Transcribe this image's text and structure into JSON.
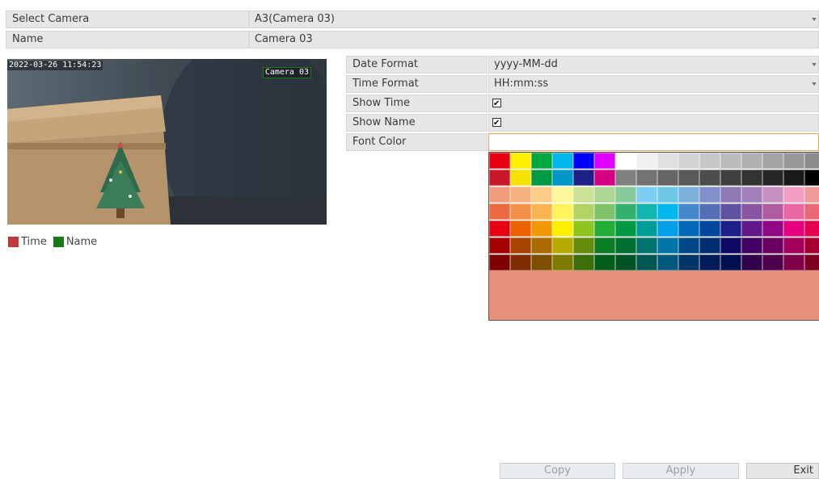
{
  "camera_row": {
    "label": "Select Camera",
    "value": "A3(Camera 03)"
  },
  "name_row": {
    "label": "Name",
    "value": "Camera 03"
  },
  "preview": {
    "timestamp": "2022-03-26 11:54:23",
    "camera_name": "Camera 03"
  },
  "legend": {
    "time_label": "Time",
    "time_color": "#c0393a",
    "name_label": "Name",
    "name_color": "#1a7a1a"
  },
  "settings": {
    "date_format": {
      "label": "Date Format",
      "value": "yyyy-MM-dd"
    },
    "time_format": {
      "label": "Time Format",
      "value": "HH:mm:ss"
    },
    "show_time": {
      "label": "Show Time",
      "checked": true,
      "mark": "✔"
    },
    "show_name": {
      "label": "Show Name",
      "checked": true,
      "mark": "✔"
    },
    "font_color": {
      "label": "Font Color",
      "value": ""
    }
  },
  "palette": {
    "selected_preview": "#e8917b",
    "rows": [
      [
        "#e60012",
        "#fff100",
        "#00a73c",
        "#00b7ee",
        "#0000ff",
        "#e100ff",
        "#ffffff",
        "#f0f0f0",
        "#e0e0e0",
        "#d4d4d4",
        "#c8c8c8",
        "#bcbcbc",
        "#b0b0b0",
        "#a4a4a4",
        "#989898",
        "#8c8c8c"
      ],
      [
        "#c9162b",
        "#f5e200",
        "#009a44",
        "#0096c8",
        "#1d2088",
        "#d70082",
        "#808080",
        "#737373",
        "#666666",
        "#595959",
        "#4d4d4d",
        "#404040",
        "#333333",
        "#262626",
        "#191919",
        "#000000"
      ],
      [
        "#f19c7c",
        "#f6b37f",
        "#facd89",
        "#fff799",
        "#cce198",
        "#acd598",
        "#88c999",
        "#7ecef4",
        "#6dc8e8",
        "#7bb0dd",
        "#8091c9",
        "#8c7ab4",
        "#a480b8",
        "#c490bf",
        "#f19ec2",
        "#f29b9b"
      ],
      [
        "#ec6941",
        "#f19149",
        "#f8b551",
        "#fff45c",
        "#b3d465",
        "#80c269",
        "#32b16c",
        "#13b5b1",
        "#00b7ee",
        "#448aca",
        "#556fb5",
        "#5f52a0",
        "#8957a1",
        "#ae5da1",
        "#ea68a2",
        "#eb6877"
      ],
      [
        "#e60012",
        "#eb6100",
        "#f39800",
        "#fff100",
        "#8fc31f",
        "#22ac38",
        "#009944",
        "#009e96",
        "#00a0e9",
        "#0068b7",
        "#00479d",
        "#1d2088",
        "#601986",
        "#920783",
        "#e4007f",
        "#e5004f"
      ],
      [
        "#a40000",
        "#a84200",
        "#ac6a00",
        "#b7aa00",
        "#638c0b",
        "#097c25",
        "#007130",
        "#00736d",
        "#0075a9",
        "#004986",
        "#002e73",
        "#100964",
        "#440062",
        "#6a005f",
        "#a4005b",
        "#a40035"
      ],
      [
        "#7f0000",
        "#7f2d00",
        "#7f4f00",
        "#7f7a00",
        "#3f6f0b",
        "#005f1b",
        "#005325",
        "#005650",
        "#00597c",
        "#003567",
        "#001c58",
        "#000f4e",
        "#30004b",
        "#4f004a",
        "#7e0046",
        "#7d0022"
      ]
    ]
  },
  "buttons": {
    "copy": "Copy",
    "apply": "Apply",
    "exit": "Exit"
  },
  "icons": {
    "dropdown": "chevron-down-icon",
    "check": "checkmark-icon"
  }
}
